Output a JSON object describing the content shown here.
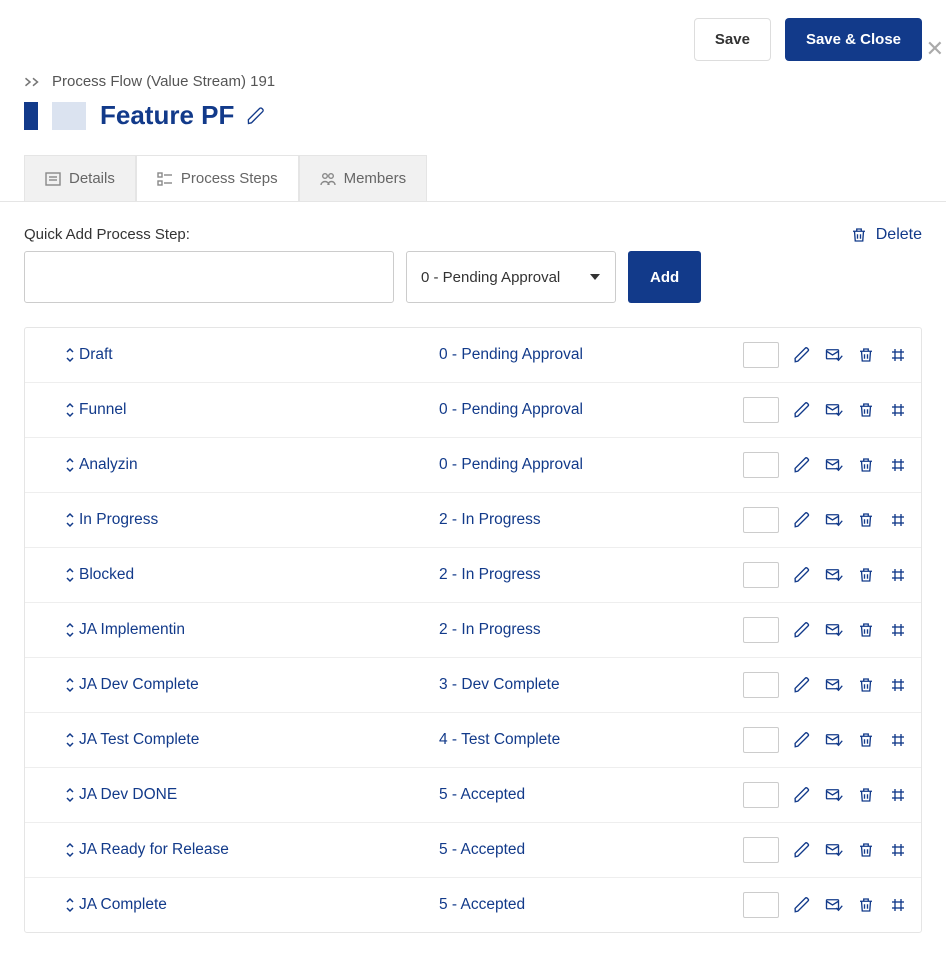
{
  "header": {
    "breadcrumb": "Process Flow (Value Stream) 191",
    "title": "Feature PF",
    "save_label": "Save",
    "save_close_label": "Save & Close"
  },
  "tabs": {
    "details": "Details",
    "process_steps": "Process Steps",
    "members": "Members"
  },
  "quick_add": {
    "label": "Quick Add Process Step:",
    "input_value": "",
    "select_value": "0 - Pending Approval",
    "add_label": "Add"
  },
  "toolbar": {
    "delete_label": "Delete"
  },
  "steps": [
    {
      "name": "Draft",
      "status": "0 - Pending Approval"
    },
    {
      "name": "Funnel",
      "status": "0 - Pending Approval"
    },
    {
      "name": "Analyzin",
      "status": "0 - Pending Approval"
    },
    {
      "name": "In Progress",
      "status": "2 - In Progress"
    },
    {
      "name": "Blocked",
      "status": "2 - In Progress"
    },
    {
      "name": "JA Implementin",
      "status": "2 - In Progress"
    },
    {
      "name": "JA Dev Complete",
      "status": "3 - Dev Complete"
    },
    {
      "name": "JA Test Complete",
      "status": "4 - Test Complete"
    },
    {
      "name": "JA Dev DONE",
      "status": "5 - Accepted"
    },
    {
      "name": "JA Ready for Release",
      "status": "5 - Accepted"
    },
    {
      "name": "JA Complete",
      "status": "5 - Accepted"
    }
  ]
}
